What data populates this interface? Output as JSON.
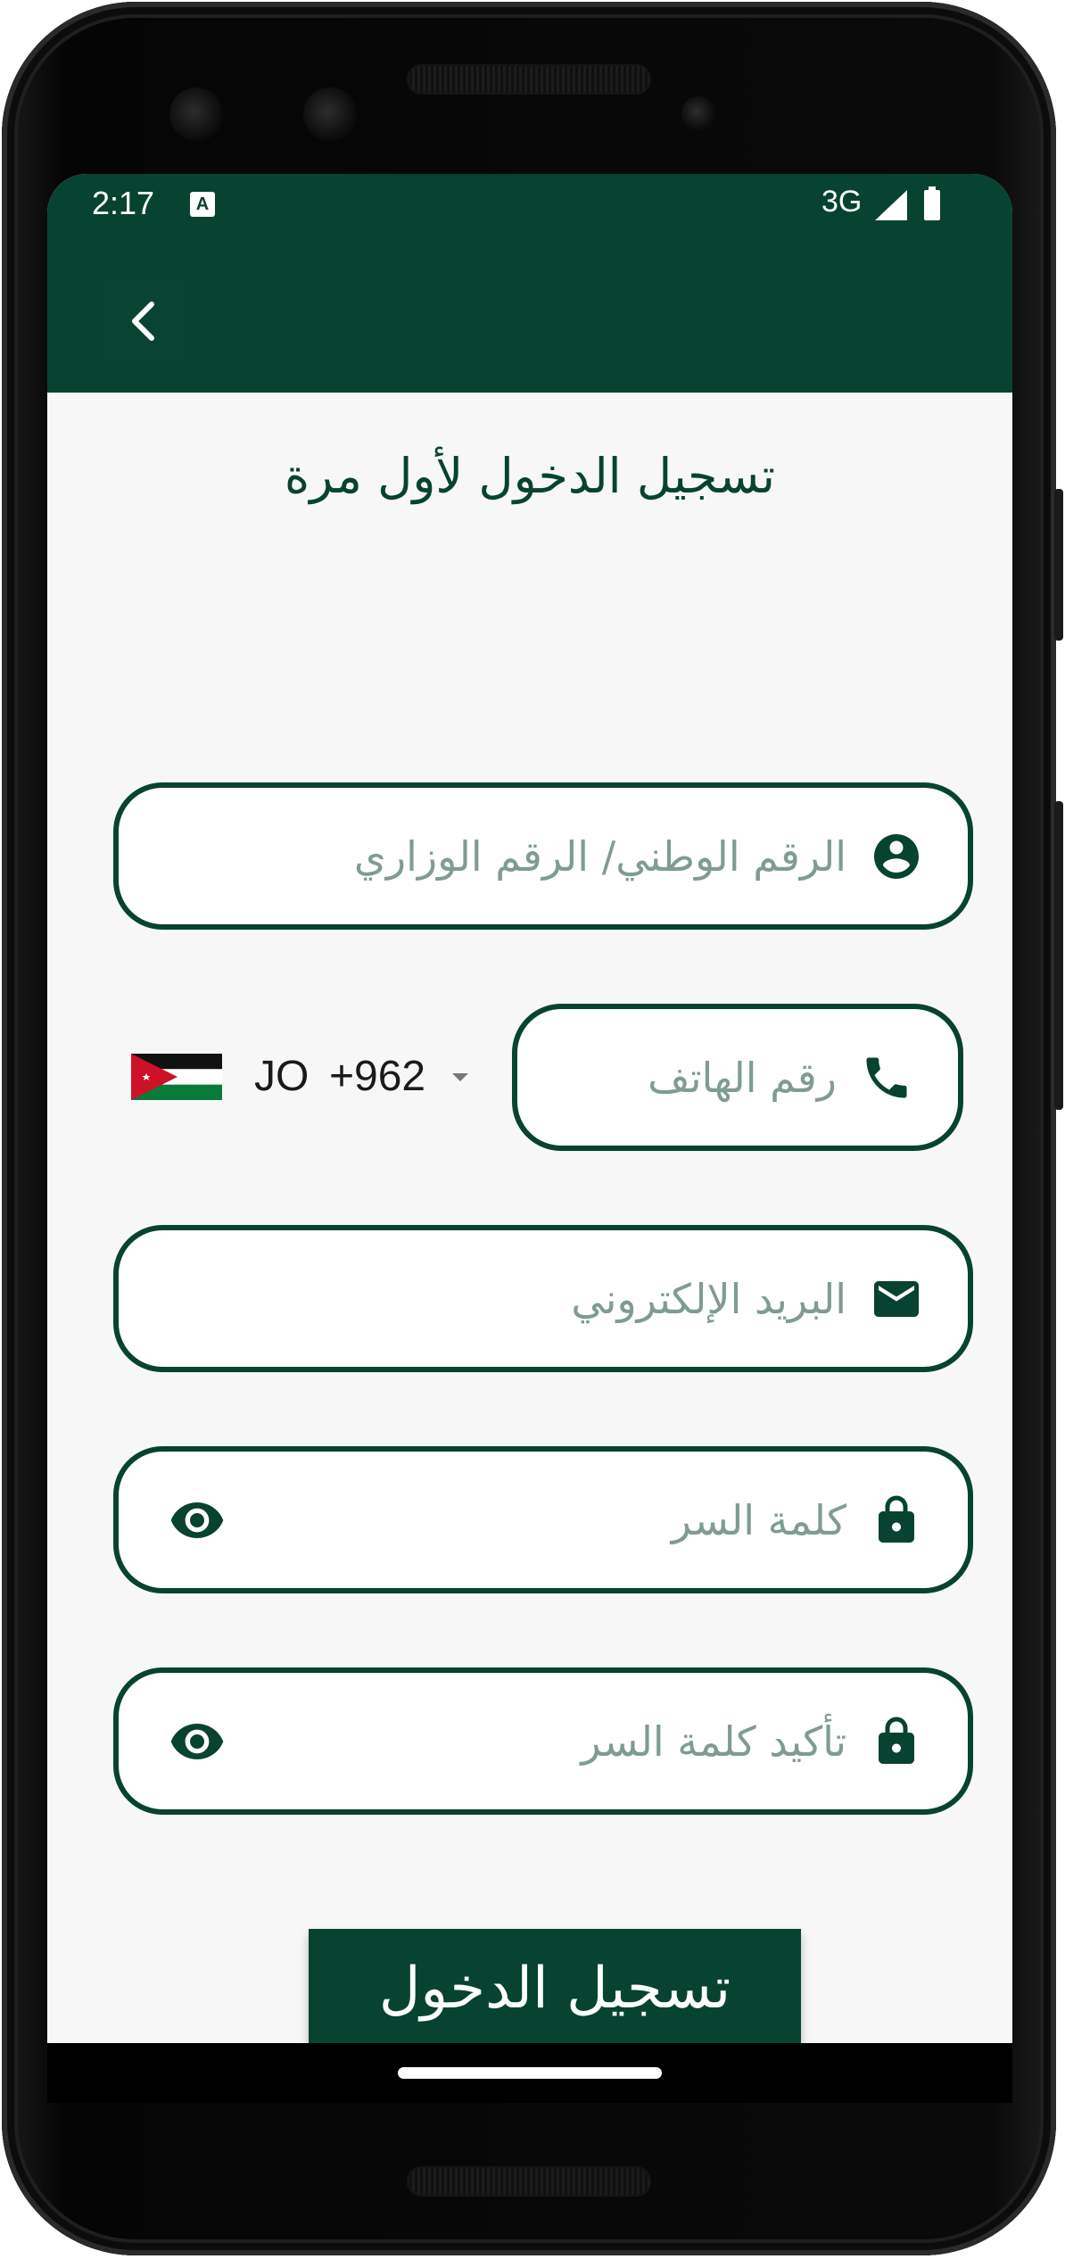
{
  "status_bar": {
    "time": "2:17",
    "notification_icon": "A",
    "network": "3G",
    "signal_icon": "signal-icon",
    "battery_icon": "battery-icon"
  },
  "app_bar": {
    "back_icon": "back-arrow-icon"
  },
  "page": {
    "title": "تسجيل الدخول لأول مرة"
  },
  "form": {
    "national_id": {
      "placeholder": "الرقم الوطني/ الرقم الوزاري",
      "icon": "account-circle-icon"
    },
    "phone": {
      "placeholder": "رقم الهاتف",
      "icon": "phone-icon"
    },
    "country_picker": {
      "country_code": "JO",
      "dial_code": "+962",
      "flag": "jordan-flag"
    },
    "email": {
      "placeholder": "البريد الإلكتروني",
      "icon": "mail-icon"
    },
    "password": {
      "placeholder": "كلمة السر",
      "icon": "lock-icon",
      "toggle_icon": "eye-icon"
    },
    "confirm_password": {
      "placeholder": "تأكيد كلمة السر",
      "icon": "lock-icon",
      "toggle_icon": "eye-icon"
    },
    "submit_label": "تسجيل الدخول"
  },
  "colors": {
    "primary": "#074330",
    "placeholder": "#7f9c91",
    "background": "#f7f7f7"
  }
}
